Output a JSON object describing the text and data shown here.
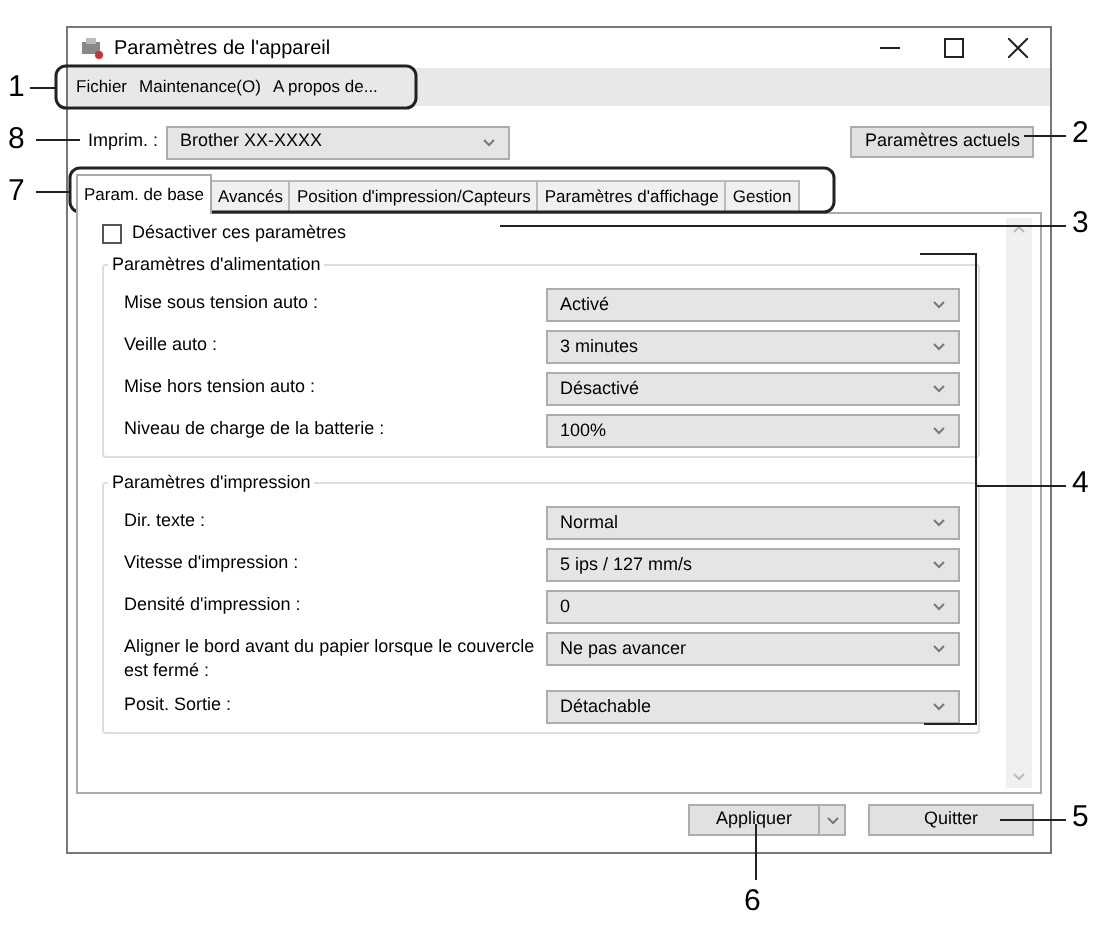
{
  "window": {
    "title": "Paramètres de l'appareil"
  },
  "menu": [
    "Fichier",
    "Maintenance(O)",
    "A propos de..."
  ],
  "printer": {
    "label": "Imprim. :",
    "value": "Brother XX-XXXX"
  },
  "current_settings_button": "Paramètres actuels",
  "tabs": [
    {
      "label": "Param. de base",
      "selected": true
    },
    {
      "label": "Avancés",
      "selected": false
    },
    {
      "label": "Position d'impression/Capteurs",
      "selected": false
    },
    {
      "label": "Paramètres d'affichage",
      "selected": false
    },
    {
      "label": "Gestion",
      "selected": false
    }
  ],
  "disable_checkbox": {
    "label": "Désactiver ces paramètres",
    "checked": false
  },
  "groups": [
    {
      "title": "Paramètres d'alimentation",
      "rows": [
        {
          "label": "Mise sous tension auto :",
          "value": "Activé"
        },
        {
          "label": "Veille auto :",
          "value": "3 minutes"
        },
        {
          "label": "Mise hors tension auto :",
          "value": "Désactivé"
        },
        {
          "label": "Niveau de charge de la batterie :",
          "value": "100%"
        }
      ]
    },
    {
      "title": "Paramètres d'impression",
      "rows": [
        {
          "label": "Dir. texte :",
          "value": "Normal"
        },
        {
          "label": "Vitesse d'impression :",
          "value": "5 ips / 127 mm/s"
        },
        {
          "label": "Densité d'impression :",
          "value": "0"
        },
        {
          "label": "Aligner le bord avant du papier lorsque le couvercle est fermé :",
          "value": "Ne pas avancer"
        },
        {
          "label": "Posit. Sortie :",
          "value": "Détachable"
        }
      ]
    }
  ],
  "buttons": {
    "apply": "Appliquer",
    "quit": "Quitter"
  },
  "callouts": [
    "1",
    "8",
    "7",
    "2",
    "3",
    "4",
    "5",
    "6"
  ]
}
